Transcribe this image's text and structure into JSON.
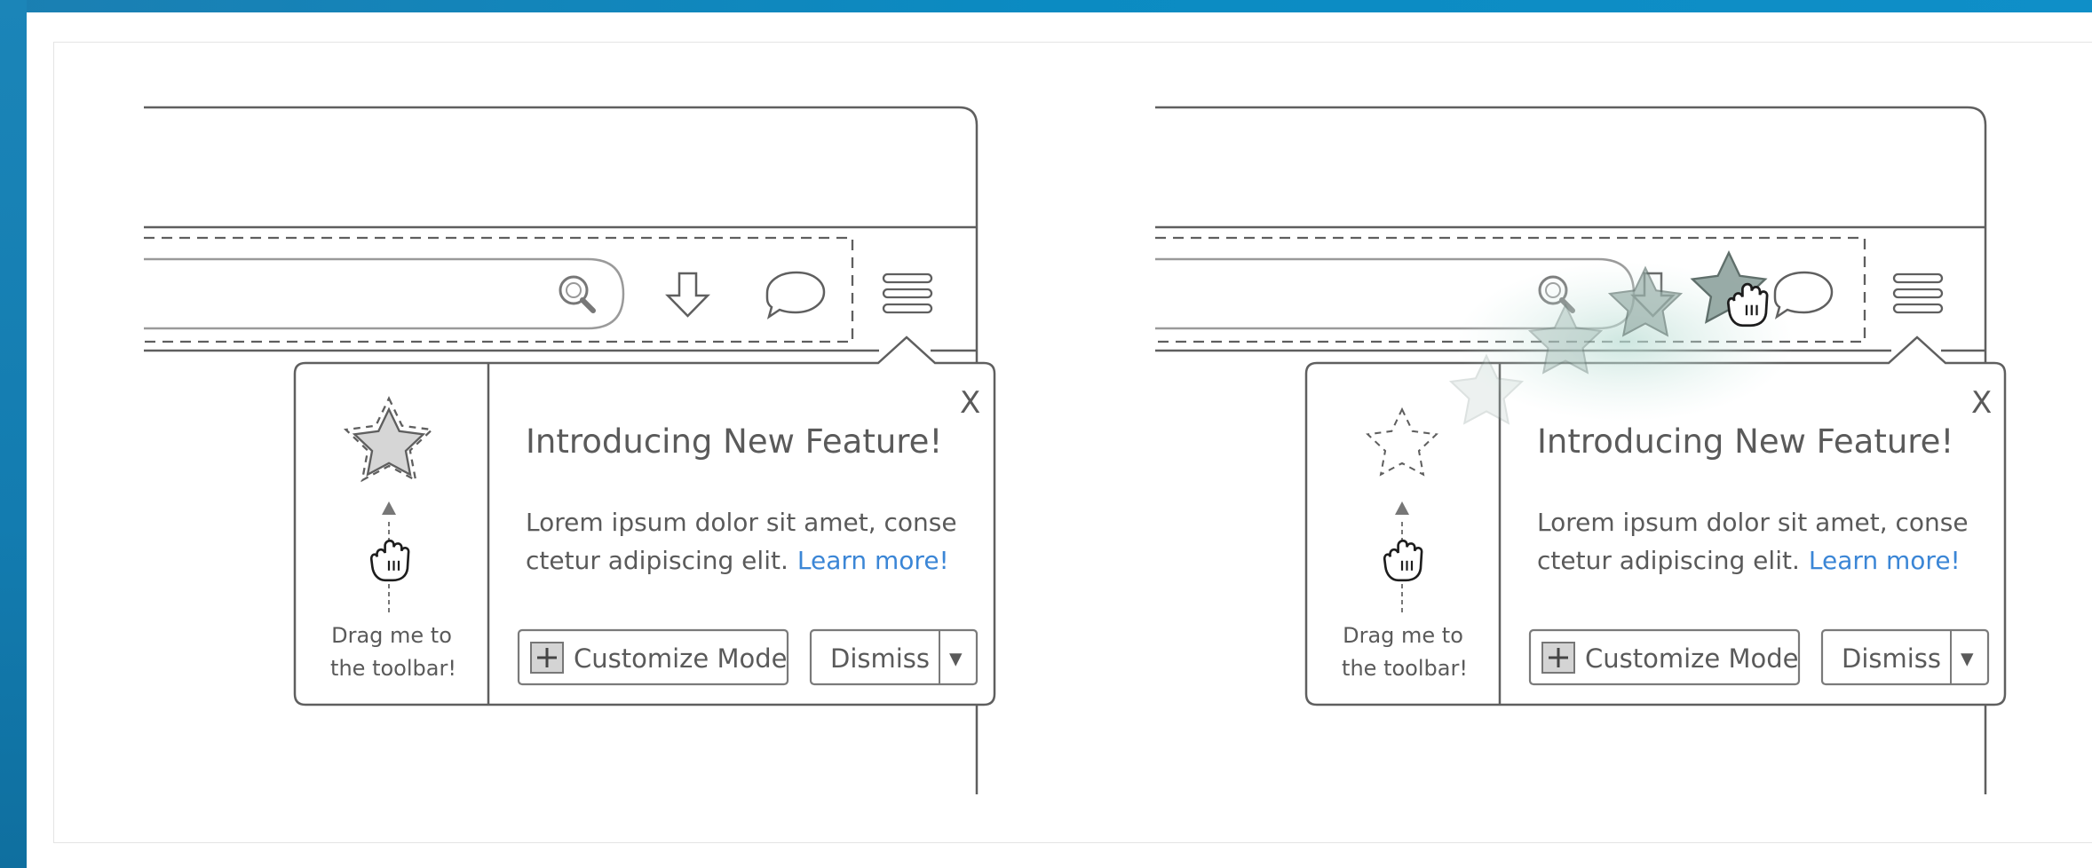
{
  "panels": [
    {
      "state": "default",
      "popup": {
        "close_label": "X",
        "title": "Introducing New Feature!",
        "body_line1": "Lorem ipsum dolor sit amet, conse",
        "body_line2": "ctetur adipiscing elit.",
        "link": "Learn more!",
        "drag_line1": "Drag me to",
        "drag_line2": "the toolbar!",
        "customize_label": "Customize Mode",
        "dismiss_label": "Dismiss",
        "dropdown_glyph": "▾"
      },
      "toolbar_icons": [
        "search-icon",
        "download-icon",
        "chat-bubble-icon",
        "hamburger-menu-icon"
      ]
    },
    {
      "state": "dragging-star-to-toolbar",
      "popup": {
        "close_label": "X",
        "title": "Introducing New Feature!",
        "body_line1": "Lorem ipsum dolor sit amet, conse",
        "body_line2": "ctetur adipiscing elit.",
        "link": "Learn more!",
        "drag_line1": "Drag me to",
        "drag_line2": "the toolbar!",
        "customize_label": "Customize Mode",
        "dismiss_label": "Dismiss",
        "dropdown_glyph": "▾"
      },
      "toolbar_icons": [
        "search-icon",
        "download-icon",
        "chat-bubble-icon",
        "hamburger-menu-icon"
      ]
    }
  ],
  "colors": {
    "stroke": "#5f5f5f",
    "link": "#3b86d6",
    "star_fill": "#d6d6d6",
    "ghost_star": "#8fa8a2",
    "background_blue": "#0b86bf"
  }
}
